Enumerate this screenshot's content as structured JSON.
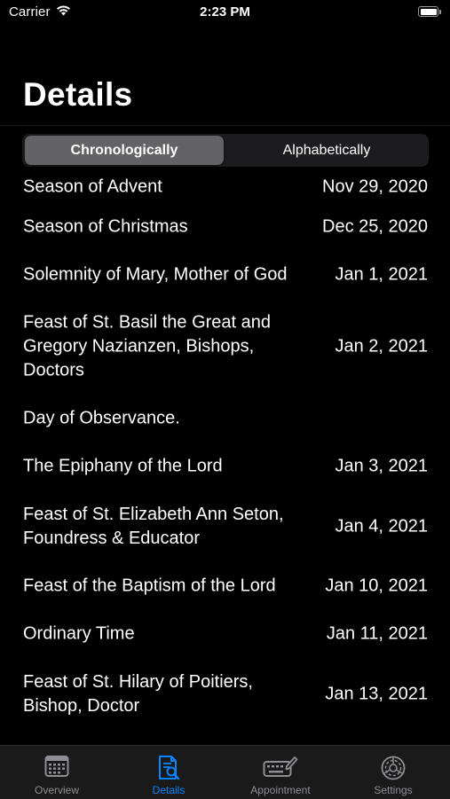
{
  "status_bar": {
    "carrier": "Carrier",
    "time": "2:23 PM"
  },
  "header": {
    "title": "Details"
  },
  "segmented_control": {
    "options": [
      "Chronologically",
      "Alphabetically"
    ],
    "selected": "Chronologically"
  },
  "events": [
    {
      "name": "Season of Advent",
      "date": "Nov 29, 2020"
    },
    {
      "name": "Season of Christmas",
      "date": "Dec 25, 2020"
    },
    {
      "name": "Solemnity of Mary, Mother of God",
      "date": "Jan 1, 2021"
    },
    {
      "name": "Feast of St. Basil the Great and Gregory Nazianzen, Bishops, Doctors",
      "date": "Jan 2, 2021"
    },
    {
      "name": "Day of Observance.",
      "date": ""
    },
    {
      "name": "The Epiphany of the Lord",
      "date": "Jan 3, 2021"
    },
    {
      "name": "Feast of St. Elizabeth Ann Seton, Foundress & Educator",
      "date": "Jan 4, 2021"
    },
    {
      "name": "Feast of the Baptism of the Lord",
      "date": "Jan 10, 2021"
    },
    {
      "name": "Ordinary Time",
      "date": "Jan 11, 2021"
    },
    {
      "name": "Feast of St. Hilary of Poitiers, Bishop, Doctor",
      "date": "Jan 13, 2021"
    }
  ],
  "tab_bar": {
    "tabs": [
      {
        "label": "Overview",
        "icon": "calendar-icon",
        "active": false
      },
      {
        "label": "Details",
        "icon": "document-search-icon",
        "active": true
      },
      {
        "label": "Appointment",
        "icon": "keyboard-pen-icon",
        "active": false
      },
      {
        "label": "Settings",
        "icon": "gear-icon",
        "active": false
      }
    ]
  },
  "colors": {
    "background": "#000000",
    "accent": "#0a84ff",
    "inactive_tab": "#8e8e93"
  }
}
